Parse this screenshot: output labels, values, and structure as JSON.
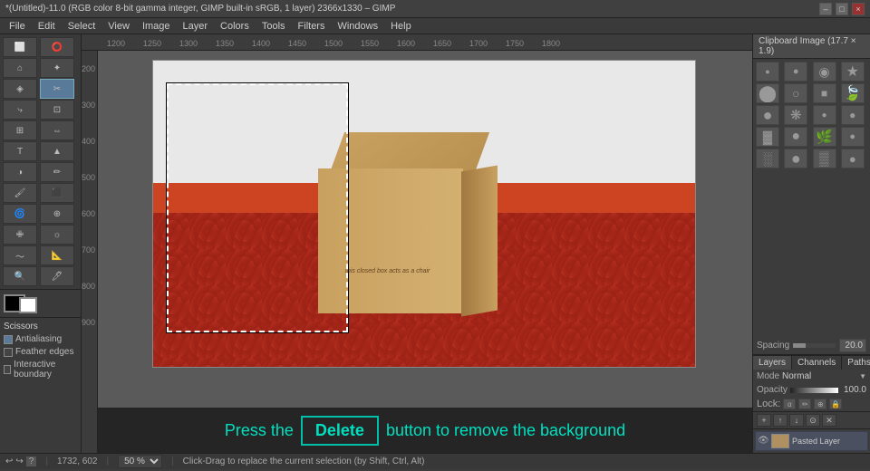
{
  "titleBar": {
    "text": "*(Untitled)-11.0 (RGB color 8-bit gamma integer, GIMP built-in sRGB, 1 layer) 2366x1330 – GIMP",
    "minimizeLabel": "–",
    "maximizeLabel": "□",
    "closeLabel": "×"
  },
  "menuBar": {
    "items": [
      "File",
      "Edit",
      "Select",
      "View",
      "Image",
      "Layer",
      "Colors",
      "Tools",
      "Filters",
      "Windows",
      "Help"
    ]
  },
  "toolbox": {
    "tools": [
      {
        "name": "rect-select",
        "icon": "⬜"
      },
      {
        "name": "ellipse-select",
        "icon": "⭕"
      },
      {
        "name": "free-select",
        "icon": "⌂"
      },
      {
        "name": "fuzzy-select",
        "icon": "✦"
      },
      {
        "name": "select-by-color",
        "icon": "◈"
      },
      {
        "name": "scissors-select",
        "icon": "✂",
        "active": true
      },
      {
        "name": "paths",
        "icon": "⤷"
      },
      {
        "name": "crop",
        "icon": "⊡"
      },
      {
        "name": "transform",
        "icon": "⊞"
      },
      {
        "name": "flip",
        "icon": "⇔"
      },
      {
        "name": "text",
        "icon": "T"
      },
      {
        "name": "fill",
        "icon": "▲"
      },
      {
        "name": "blend",
        "icon": "◑"
      },
      {
        "name": "pencil",
        "icon": "✏"
      },
      {
        "name": "paintbrush",
        "icon": "🖌"
      },
      {
        "name": "eraser",
        "icon": "⬛"
      },
      {
        "name": "airbrush",
        "icon": "🌀"
      },
      {
        "name": "clone",
        "icon": "⊕"
      },
      {
        "name": "heal",
        "icon": "✙"
      },
      {
        "name": "dodge-burn",
        "icon": "☼"
      },
      {
        "name": "smudge",
        "icon": "〜"
      },
      {
        "name": "measure",
        "icon": "📐"
      },
      {
        "name": "zoom",
        "icon": "🔍"
      },
      {
        "name": "color-picker",
        "icon": "🖊"
      }
    ],
    "toolName": "Scissors",
    "options": {
      "antialiasing": {
        "label": "Antialiasing",
        "checked": true
      },
      "featherEdges": {
        "label": "Feather edges",
        "checked": false
      },
      "interactiveBoundary": {
        "label": "Interactive boundary",
        "checked": false
      }
    }
  },
  "ruler": {
    "hTicks": [
      "1200",
      "1250",
      "1300",
      "1350",
      "1400",
      "1450",
      "1500",
      "1550",
      "1600",
      "1650",
      "1700",
      "1750",
      "1800"
    ],
    "vTicks": [
      "200",
      "300",
      "400",
      "500",
      "600",
      "700",
      "800",
      "900"
    ]
  },
  "brushesPanel": {
    "title": "Clipboard Image (17.7 × 1.9)",
    "brushes": [
      {
        "type": "circle",
        "size": 3
      },
      {
        "type": "circle",
        "size": 5
      },
      {
        "type": "circle",
        "size": 8
      },
      {
        "type": "star",
        "size": 10
      },
      {
        "type": "circle",
        "size": 12
      },
      {
        "type": "ring",
        "size": 8
      },
      {
        "type": "square",
        "size": 6
      },
      {
        "type": "leaf",
        "size": 10
      },
      {
        "type": "circle",
        "size": 14
      },
      {
        "type": "spikey",
        "size": 9
      },
      {
        "type": "circle",
        "size": 4
      },
      {
        "type": "circle",
        "size": 6
      },
      {
        "type": "texture",
        "size": 8
      },
      {
        "type": "circle",
        "size": 10
      },
      {
        "type": "leaf2",
        "size": 9
      },
      {
        "type": "circle",
        "size": 5
      },
      {
        "type": "spatter",
        "size": 8
      },
      {
        "type": "circle",
        "size": 12
      },
      {
        "type": "texture2",
        "size": 9
      },
      {
        "type": "circle",
        "size": 7
      }
    ]
  },
  "spacingSection": {
    "label": "Spacing",
    "value": "20.0"
  },
  "layersPanel": {
    "tabs": [
      "Layers",
      "Channels",
      "Paths"
    ],
    "activeTab": "Layers",
    "mode": {
      "label": "Mode",
      "value": "Normal"
    },
    "opacity": {
      "label": "Opacity",
      "value": "100.0"
    },
    "lock": {
      "label": "Lock:"
    },
    "buttons": [
      {
        "name": "new-layer",
        "icon": "+"
      },
      {
        "name": "raise-layer",
        "icon": "↑"
      },
      {
        "name": "lower-layer",
        "icon": "↓"
      },
      {
        "name": "duplicate-layer",
        "icon": "⊙"
      },
      {
        "name": "delete-layer",
        "icon": "✕"
      }
    ],
    "layers": [
      {
        "name": "Pasted Layer",
        "visible": true
      }
    ]
  },
  "instruction": {
    "pressThe": "Press the",
    "deleteKey": "Delete",
    "restText": "button to remove the background"
  },
  "statusBar": {
    "coords": "1732, 602",
    "zoom": {
      "value": "50",
      "unit": "%"
    },
    "hint": "Click-Drag to replace the current selection (by Shift, Ctrl, Alt)"
  },
  "bottomControls": {
    "undoLabel": "↩",
    "redoLabel": "↪",
    "helpLabel": "?"
  }
}
